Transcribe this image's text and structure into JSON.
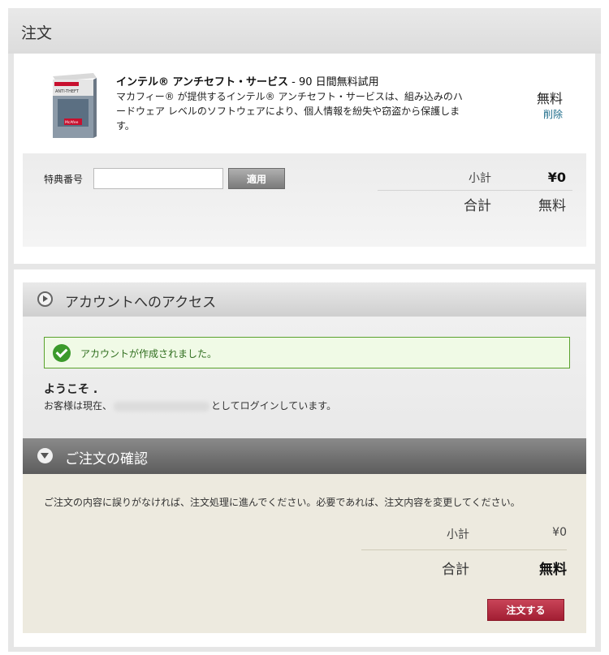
{
  "order": {
    "title": "注文",
    "product": {
      "box_label": "ANTI-THEFT",
      "box_brand": "McAfee",
      "name": "インテル® アンチセフト・サービス",
      "trial": " - 90 日間無料試用",
      "description": "マカフィー® が提供するインテル® アンチセフト・サービスは、組み込みのハードウェア レベルのソフトウェアにより、個人情報を紛失や窃盗から保護します。",
      "price": "無料",
      "remove_label": "削除"
    },
    "coupon": {
      "label": "特典番号",
      "value": "",
      "apply_label": "適用"
    },
    "summary": {
      "subtotal_label": "小計",
      "subtotal_value": "¥0",
      "total_label": "合計",
      "total_value": "無料"
    }
  },
  "account": {
    "title": "アカウントへのアクセス",
    "success_message": "アカウントが作成されました。",
    "welcome": "ようこそ .",
    "login_prefix": "お客様は現在、",
    "login_suffix": "としてログインしています。"
  },
  "confirm": {
    "title": "ご注文の確認",
    "instruction": "ご注文の内容に誤りがなければ、注文処理に進んでください。必要であれば、注文内容を変更してください。",
    "subtotal_label": "小計",
    "subtotal_value": "¥0",
    "total_label": "合計",
    "total_value": "無料",
    "order_button": "注文する"
  },
  "colors": {
    "success_green": "#3b9a2b",
    "order_button_red": "#b02a3e",
    "link_blue": "#1d6c8a",
    "confirm_bg": "#edeadf"
  }
}
